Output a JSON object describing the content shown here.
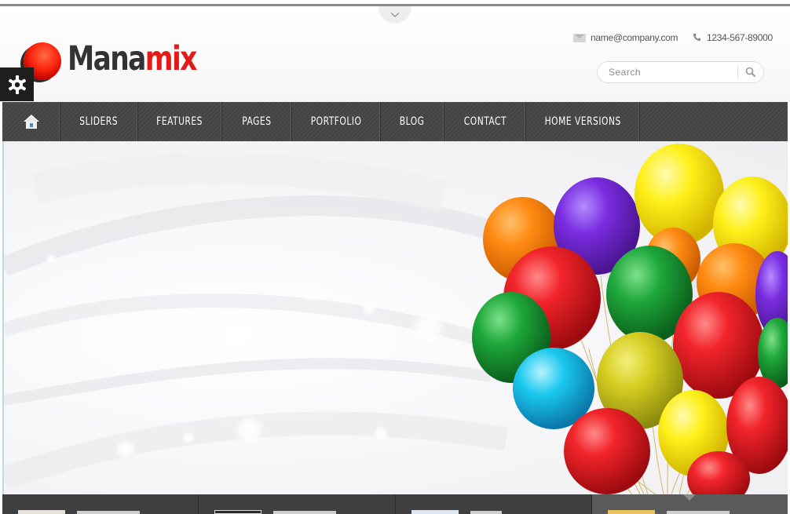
{
  "header": {
    "logo": {
      "part1": "Mana",
      "part2": "mix"
    },
    "contact": {
      "email": "name@company.com",
      "phone": "1234-567-89000"
    },
    "search": {
      "placeholder": "Search"
    }
  },
  "nav": {
    "items": [
      {
        "label": "SLIDERS"
      },
      {
        "label": "FEATURES"
      },
      {
        "label": "PAGES"
      },
      {
        "label": "PORTFOLIO"
      },
      {
        "label": "BLOG"
      },
      {
        "label": "CONTACT"
      },
      {
        "label": "HOME VERSIONS"
      }
    ]
  },
  "colors": {
    "nav_bg": "#484848",
    "logo_accent": "#e21a1a",
    "logo_dark": "#333333"
  },
  "icons": {
    "nav_home": "home-icon",
    "settings": "gear-icon",
    "search": "magnifier-icon",
    "email": "envelope-icon",
    "phone": "phone-icon"
  }
}
